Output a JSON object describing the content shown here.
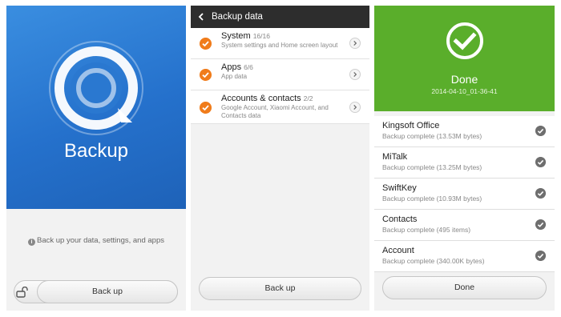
{
  "screen1": {
    "title": "Backup",
    "hint": "Back up your data, settings, and apps",
    "backup_button": "Back up"
  },
  "screen2": {
    "header_title": "Backup data",
    "items": [
      {
        "name": "System",
        "count": "16/16",
        "desc": "System settings and Home screen layout"
      },
      {
        "name": "Apps",
        "count": "6/6",
        "desc": "App data"
      },
      {
        "name": "Accounts & contacts",
        "count": "2/2",
        "desc": "Google Account, Xiaomi Account, and Contacts data"
      }
    ],
    "backup_button": "Back up"
  },
  "screen3": {
    "title": "Done",
    "timestamp": "2014-04-10_01-36-41",
    "items": [
      {
        "name": "Kingsoft Office",
        "status": "Backup complete (13.53M  bytes)"
      },
      {
        "name": "MiTalk",
        "status": "Backup complete (13.25M  bytes)"
      },
      {
        "name": "SwiftKey",
        "status": "Backup complete (10.93M  bytes)"
      },
      {
        "name": "Contacts",
        "status": "Backup complete (495  items)"
      },
      {
        "name": "Account",
        "status": "Backup complete (340.00K  bytes)"
      }
    ],
    "done_button": "Done"
  },
  "colors": {
    "blue_hero": "#2571cc",
    "green_hero": "#5aae2b",
    "orange_check": "#f07c1b",
    "title_bar": "#2d2d2d"
  },
  "icons": {
    "backup_logo": "backup-logo-icon",
    "info": "info-icon",
    "unlock": "unlock-icon",
    "back": "back-arrow-icon",
    "checked": "check-icon",
    "chevron": "chevron-right-icon",
    "done": "done-check-icon"
  }
}
